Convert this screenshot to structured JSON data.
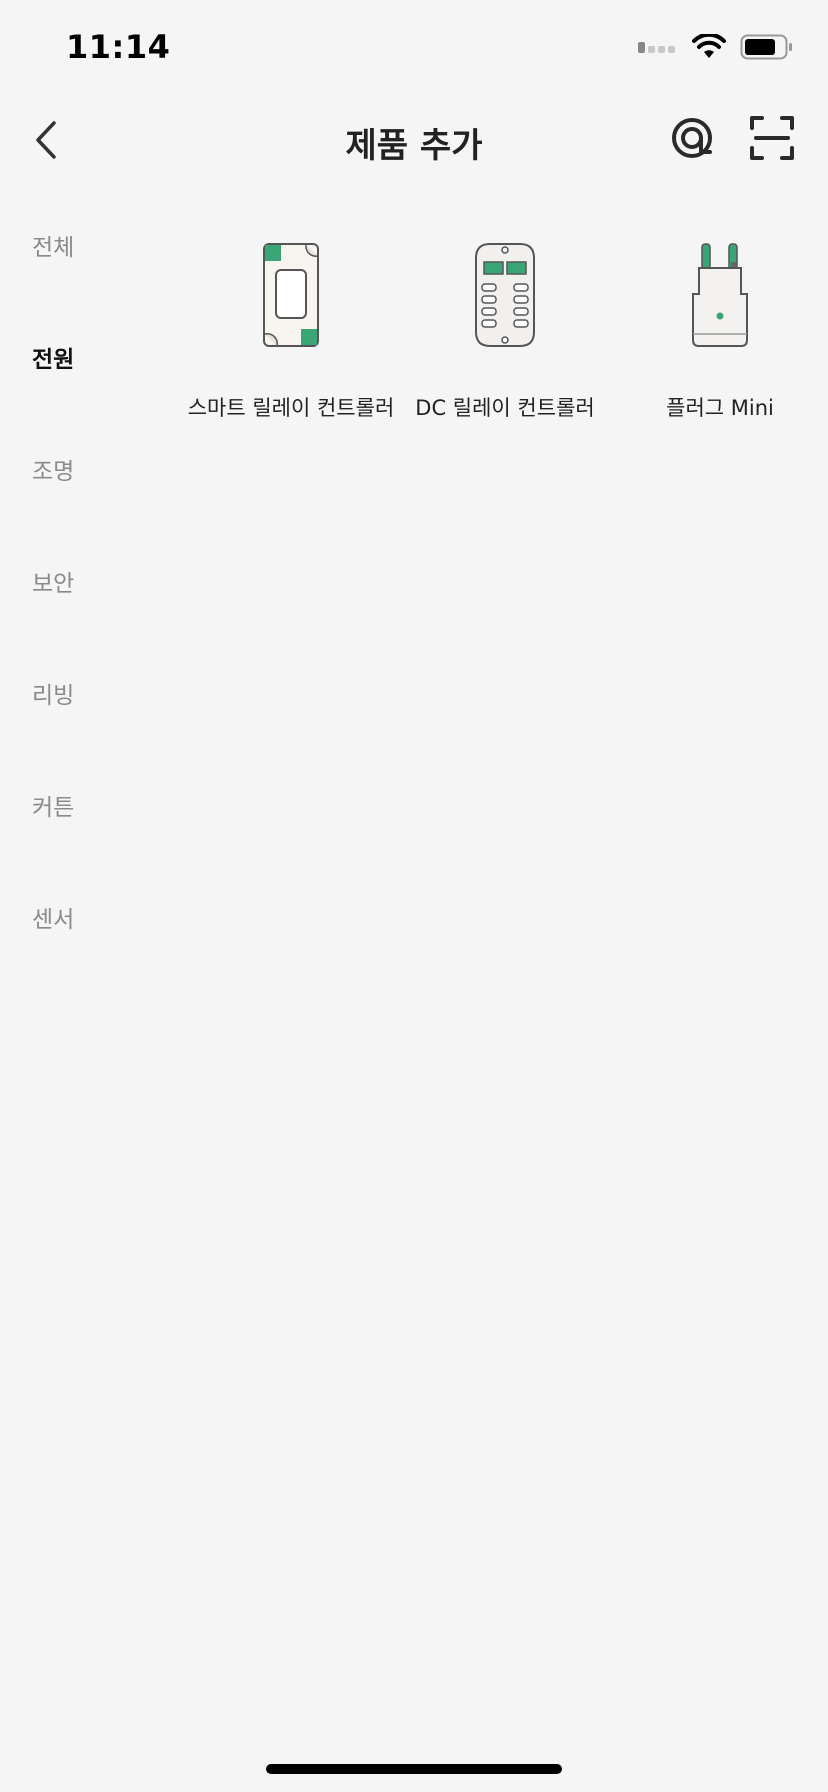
{
  "status_bar": {
    "time": "11:14"
  },
  "nav": {
    "title": "제품 추가"
  },
  "sidebar": {
    "items": [
      {
        "label": "전체",
        "active": false
      },
      {
        "label": "전원",
        "active": true
      },
      {
        "label": "조명",
        "active": false
      },
      {
        "label": "보안",
        "active": false
      },
      {
        "label": "리빙",
        "active": false
      },
      {
        "label": "커튼",
        "active": false
      },
      {
        "label": "센서",
        "active": false
      }
    ]
  },
  "products": [
    {
      "label": "스마트 릴레이 컨트롤러",
      "icon": "smart-relay-icon"
    },
    {
      "label": "DC 릴레이 컨트롤러",
      "icon": "dc-relay-icon"
    },
    {
      "label": "플러그 Mini",
      "icon": "plug-mini-icon"
    }
  ],
  "colors": {
    "accent_green": "#3aa676",
    "background": "#f5f5f5"
  }
}
